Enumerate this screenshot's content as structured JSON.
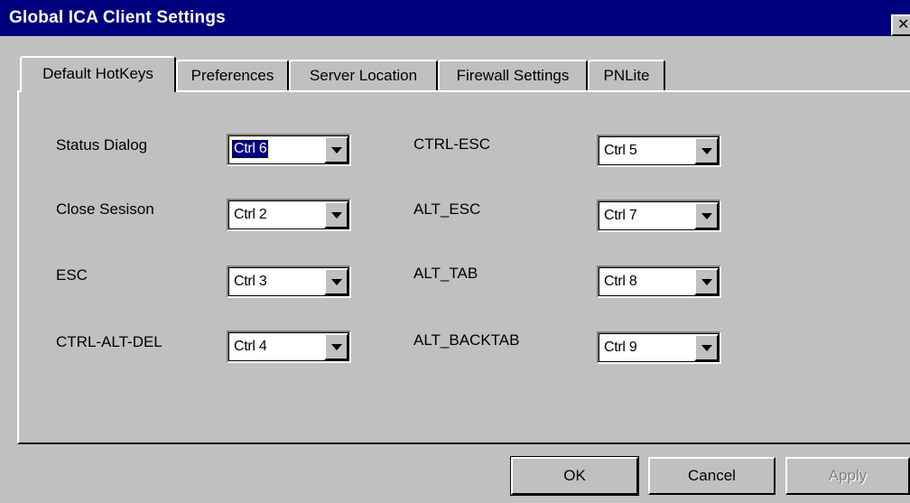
{
  "window": {
    "title": "Global ICA Client Settings",
    "close_glyph": "✕"
  },
  "tabs": [
    {
      "label": "Default HotKeys",
      "active": true
    },
    {
      "label": "Preferences",
      "active": false
    },
    {
      "label": "Server Location",
      "active": false
    },
    {
      "label": "Firewall Settings",
      "active": false
    },
    {
      "label": "PNLite",
      "active": false
    }
  ],
  "hotkeys": {
    "status_dialog": {
      "label": "Status Dialog",
      "value": "Ctrl 6"
    },
    "close_session": {
      "label": "Close Sesison",
      "value": "Ctrl 2"
    },
    "esc": {
      "label": "ESC",
      "value": "Ctrl 3"
    },
    "ctrl_alt_del": {
      "label": "CTRL-ALT-DEL",
      "value": "Ctrl 4"
    },
    "ctrl_esc": {
      "label": "CTRL-ESC",
      "value": "Ctrl 5"
    },
    "alt_esc": {
      "label": "ALT_ESC",
      "value": "Ctrl 7"
    },
    "alt_tab": {
      "label": "ALT_TAB",
      "value": "Ctrl 8"
    },
    "alt_backtab": {
      "label": "ALT_BACKTAB",
      "value": "Ctrl 9"
    }
  },
  "buttons": {
    "ok": "OK",
    "cancel": "Cancel",
    "apply": "Apply"
  },
  "colors": {
    "titlebar": "#00007f",
    "face": "#c0c0c0"
  }
}
